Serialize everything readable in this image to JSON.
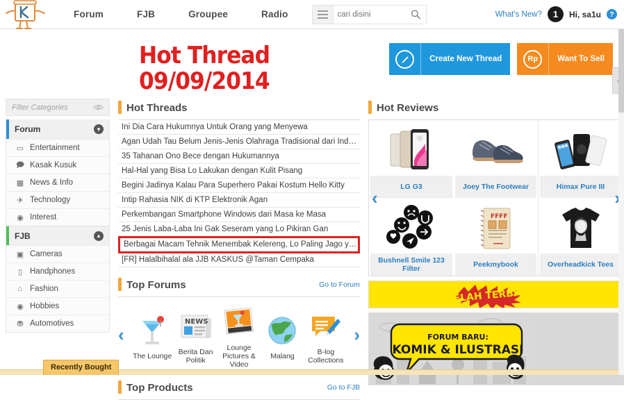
{
  "header": {
    "logo_alt": "kaskus-logo",
    "nav": [
      {
        "label": "Forum"
      },
      {
        "label": "FJB"
      },
      {
        "label": "Groupee"
      },
      {
        "label": "Radio"
      }
    ],
    "search_placeholder": "cari disini",
    "search_value": "",
    "whats_new": "What's New?",
    "avatar_badge": "1",
    "greeting": "Hi, sa1u",
    "help": "?"
  },
  "actions": {
    "create_thread": {
      "label": "Create New Thread",
      "icon": "pencil-icon",
      "color": "#1f97dd"
    },
    "want_to_sell": {
      "label": "Want To Sell",
      "icon": "rupiah-icon",
      "color": "#f58a1f"
    }
  },
  "collapse_tab": "‹",
  "sidebar": {
    "filter_placeholder": "Filter Categories",
    "eye_icon": "eye-icon",
    "groups": [
      {
        "title": "Forum",
        "accent": "#2d8fd5",
        "chevron": "▼",
        "items": [
          {
            "label": "Entertainment",
            "icon": "tv-icon"
          },
          {
            "label": "Kasak Kusuk",
            "icon": "chat-icon"
          },
          {
            "label": "News & Info",
            "icon": "briefcase-icon"
          },
          {
            "label": "Technology",
            "icon": "rocket-icon"
          },
          {
            "label": "Interest",
            "icon": "palette-icon"
          }
        ]
      },
      {
        "title": "FJB",
        "accent": "#4fbf5a",
        "chevron": "▲",
        "items": [
          {
            "label": "Cameras",
            "icon": "camera-icon"
          },
          {
            "label": "Handphones",
            "icon": "phone-icon"
          },
          {
            "label": "Fashion",
            "icon": "hanger-icon"
          },
          {
            "label": "Hobbies",
            "icon": "palette-icon"
          },
          {
            "label": "Automotives",
            "icon": "car-icon"
          }
        ]
      }
    ]
  },
  "hot_threads": {
    "title": "Hot Threads",
    "items": [
      {
        "label": "Ini Dia Cara Hukumnya Untuk Orang yang Menyewa",
        "highlight": false
      },
      {
        "label": "Agan Udah Tau Belum Jenis-Jenis Olahraga Tradisional dari Indonesia?",
        "highlight": false
      },
      {
        "label": "35 Tahanan Ono Bece dengan Hukumannya",
        "highlight": false
      },
      {
        "label": "Hal-Hal yang Bisa Lo Lakukan dengan Kulit Pisang",
        "highlight": false
      },
      {
        "label": "Begini Jadinya Kalau Para Superhero Pakai Kostum Hello Kitty",
        "highlight": false
      },
      {
        "label": "Intip Rahasia NIK di KTP Elektronik Agan",
        "highlight": false
      },
      {
        "label": "Perkembangan Smartphone Windows dari Masa ke Masa",
        "highlight": false
      },
      {
        "label": "25 Jenis Laba-Laba Ini Gak Seseram yang Lo Pikiran Gan",
        "highlight": false
      },
      {
        "label": "Berbagai Macam Tehnik Menembak Kelereng, Lo Paling Jago yang Mana?",
        "highlight": true
      },
      {
        "label": "[FR] Halalbihalal ala JJB KASKUS @Taman Cempaka",
        "highlight": false
      }
    ]
  },
  "stamp": {
    "line1": "Hot Thread",
    "line2": "09/09/2014",
    "color": "#e02020"
  },
  "hot_reviews": {
    "title": "Hot Reviews",
    "prev_arrow": "‹",
    "next_arrow": "›",
    "items": [
      {
        "label": "LG G3",
        "icon": "smartphone-icon"
      },
      {
        "label": "Joey The Footwear",
        "icon": "shoes-icon"
      },
      {
        "label": "Himax Pure III",
        "icon": "smartphone-icon"
      },
      {
        "label": "Bushnell Smile 123 Filter",
        "icon": "emoji-badges-icon"
      },
      {
        "label": "Peekmybook",
        "icon": "notebook-icon"
      },
      {
        "label": "Overheadkick Tees",
        "icon": "tshirt-icon"
      }
    ]
  },
  "top_forums": {
    "title": "Top Forums",
    "link": "Go to Forum",
    "prev_arrow": "‹",
    "next_arrow": "›",
    "items": [
      {
        "label": "The Lounge",
        "icon": "cocktail-icon"
      },
      {
        "label": "Berita Dan Politik",
        "icon": "newspaper-icon"
      },
      {
        "label": "Lounge Pictures & Video",
        "icon": "photo-icon"
      },
      {
        "label": "Malang",
        "icon": "globe-icon"
      },
      {
        "label": "B-log Collections",
        "icon": "pencil-note-icon"
      }
    ]
  },
  "top_products": {
    "title": "Top Products",
    "link": "Go to FJB"
  },
  "banners": {
    "banner1_text": "TELAH TERBIT!",
    "banner2_line1": "FORUM BARU:",
    "banner2_line2": "KOMIK & ILUSTRASI"
  },
  "recently_bought": "Recently Bought"
}
